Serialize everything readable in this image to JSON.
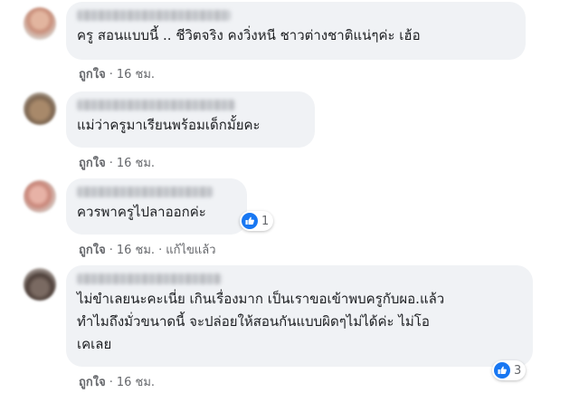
{
  "comments": [
    {
      "text_lines": [
        "ครู สอนแบบนี้ .. ชีวิตจริง คงวิ่งหนี ชาวต่างชาติแน่ๆค่ะ เฮ้อ"
      ],
      "meta": {
        "like": "ถูกใจ",
        "time": "16 ชม."
      }
    },
    {
      "text_lines": [
        "แม่ว่าครูมาเรียนพร้อมเด็กมั้ยคะ"
      ],
      "meta": {
        "like": "ถูกใจ",
        "time": "16 ชม."
      }
    },
    {
      "text_lines": [
        "ควรพาครูไปลาออกค่ะ"
      ],
      "meta": {
        "like": "ถูกใจ",
        "time": "16 ชม.",
        "edited": "แก้ไขแล้ว"
      },
      "reaction": {
        "icon": "thumbs-up-icon",
        "count": "1"
      }
    },
    {
      "text_lines": [
        "ไม่ขำเลยนะคะเนี่ย เกินเรื่องมาก เป็นเราขอเข้าพบครูกับผอ.แล้ว",
        "ทำไมถึงมั่วขนาดนี้ จะปล่อยให้สอนกันแบบผิดๆไม่ได้ค่ะ ไม่โอ",
        "เคเลย"
      ],
      "meta": {
        "like": "ถูกใจ",
        "time": "16 ชม."
      },
      "reaction": {
        "icon": "thumbs-up-icon",
        "count": "3"
      }
    }
  ],
  "colors": {
    "bubble": "#f0f2f5",
    "text": "#1c1e21",
    "meta": "#65676b",
    "like_blue": "#1877f2"
  }
}
